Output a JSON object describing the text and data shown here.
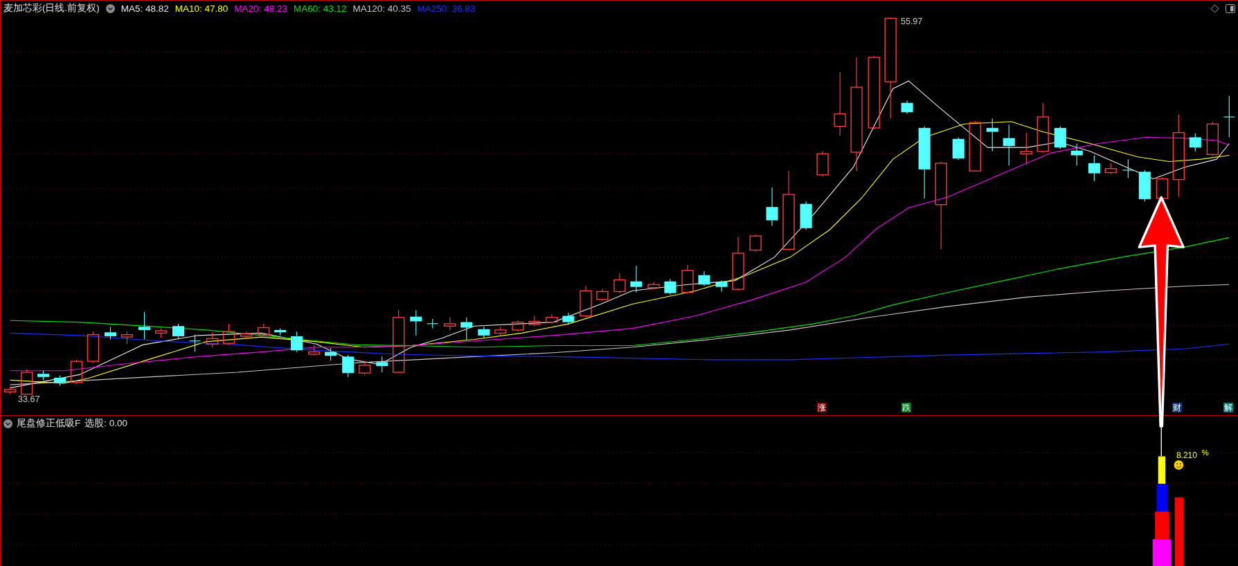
{
  "header": {
    "title": "麦加芯彩(日线.前复权)",
    "averages": [
      {
        "text": "MA5: 48.82",
        "color": "#e8e8e8"
      },
      {
        "text": "MA10: 47.80",
        "color": "#ffff00"
      },
      {
        "text": "MA20: 48.23",
        "color": "#ff00ff"
      },
      {
        "text": "MA60: 43.12",
        "color": "#00e600"
      },
      {
        "text": "MA120: 40.35",
        "color": "#c8c8c8"
      },
      {
        "text": "MA250: 36.83",
        "color": "#1432ff"
      }
    ]
  },
  "price_chart": {
    "high_label": "55.97",
    "low_label": "33.67",
    "markers": [
      {
        "label": "涨",
        "color": "#8a0000"
      },
      {
        "label": "跌",
        "color": "#007a1a"
      },
      {
        "label": "财",
        "color": "#163a78"
      },
      {
        "label": "解",
        "color": "#007878"
      }
    ]
  },
  "indicator": {
    "name": "尾盘修正低吸F",
    "reading": "选股: 0.00",
    "value": "8.210",
    "unit": "%"
  }
}
